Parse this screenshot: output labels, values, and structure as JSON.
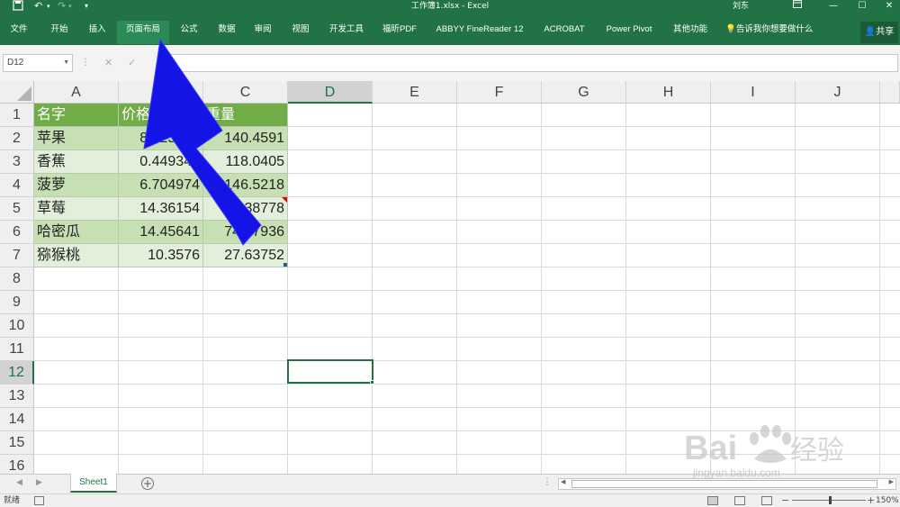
{
  "title_bar": {
    "title": "工作簿1.xlsx  -  Excel",
    "user": "刘东",
    "icons": [
      "save-icon",
      "undo-icon",
      "redo-icon",
      "customize-icon",
      "ribbon-display-icon",
      "minimize-icon",
      "maximize-icon",
      "close-icon"
    ]
  },
  "ribbon": {
    "tabs": [
      {
        "label": "文件"
      },
      {
        "label": "开始"
      },
      {
        "label": "插入"
      },
      {
        "label": "页面布局"
      },
      {
        "label": "公式"
      },
      {
        "label": "数据"
      },
      {
        "label": "审阅"
      },
      {
        "label": "视图"
      },
      {
        "label": "开发工具"
      },
      {
        "label": "福昕PDF"
      },
      {
        "label": "ABBYY FineReader 12"
      },
      {
        "label": "ACROBAT"
      },
      {
        "label": "Power Pivot"
      },
      {
        "label": "其他功能"
      },
      {
        "label": "告诉我你想要做什么"
      }
    ],
    "active_tab": "页面布局",
    "share_label": "共享"
  },
  "formula_bar": {
    "name_box": "D12",
    "formula": ""
  },
  "grid": {
    "columns": [
      "A",
      "B",
      "C",
      "D",
      "E",
      "F",
      "G",
      "H",
      "I",
      "J"
    ],
    "selected_column": "D",
    "rows": [
      "1",
      "2",
      "3",
      "4",
      "5",
      "6",
      "7",
      "8",
      "9",
      "10",
      "11",
      "12",
      "13",
      "14",
      "15",
      "16"
    ],
    "selected_row": "12",
    "selected_cell": "D12"
  },
  "table": {
    "headers": [
      "名字",
      "价格",
      "重量"
    ],
    "rows": [
      [
        "苹果",
        "8.025042",
        "140.4591"
      ],
      [
        "香蕉",
        "0.449341",
        "118.0405"
      ],
      [
        "菠萝",
        "6.704974",
        "146.5218"
      ],
      [
        "草莓",
        "14.36154",
        "77.38778"
      ],
      [
        "哈密瓜",
        "14.45641",
        "74.37936"
      ],
      [
        "猕猴桃",
        "10.3576",
        "27.63752"
      ]
    ],
    "colors": {
      "header": "#70ad47",
      "band1": "#c6e0b4",
      "band2": "#e2efda"
    }
  },
  "sheets": {
    "tabs": [
      {
        "label": "Sheet1"
      }
    ],
    "active": "Sheet1"
  },
  "status_bar": {
    "ready": "就绪",
    "zoom": "150%",
    "zoom_fraction": 0.5
  },
  "annotation": {
    "arrow_color": "#1414e6",
    "target": "页面布局"
  },
  "watermark": {
    "text": "jingyan.baidu.com"
  }
}
